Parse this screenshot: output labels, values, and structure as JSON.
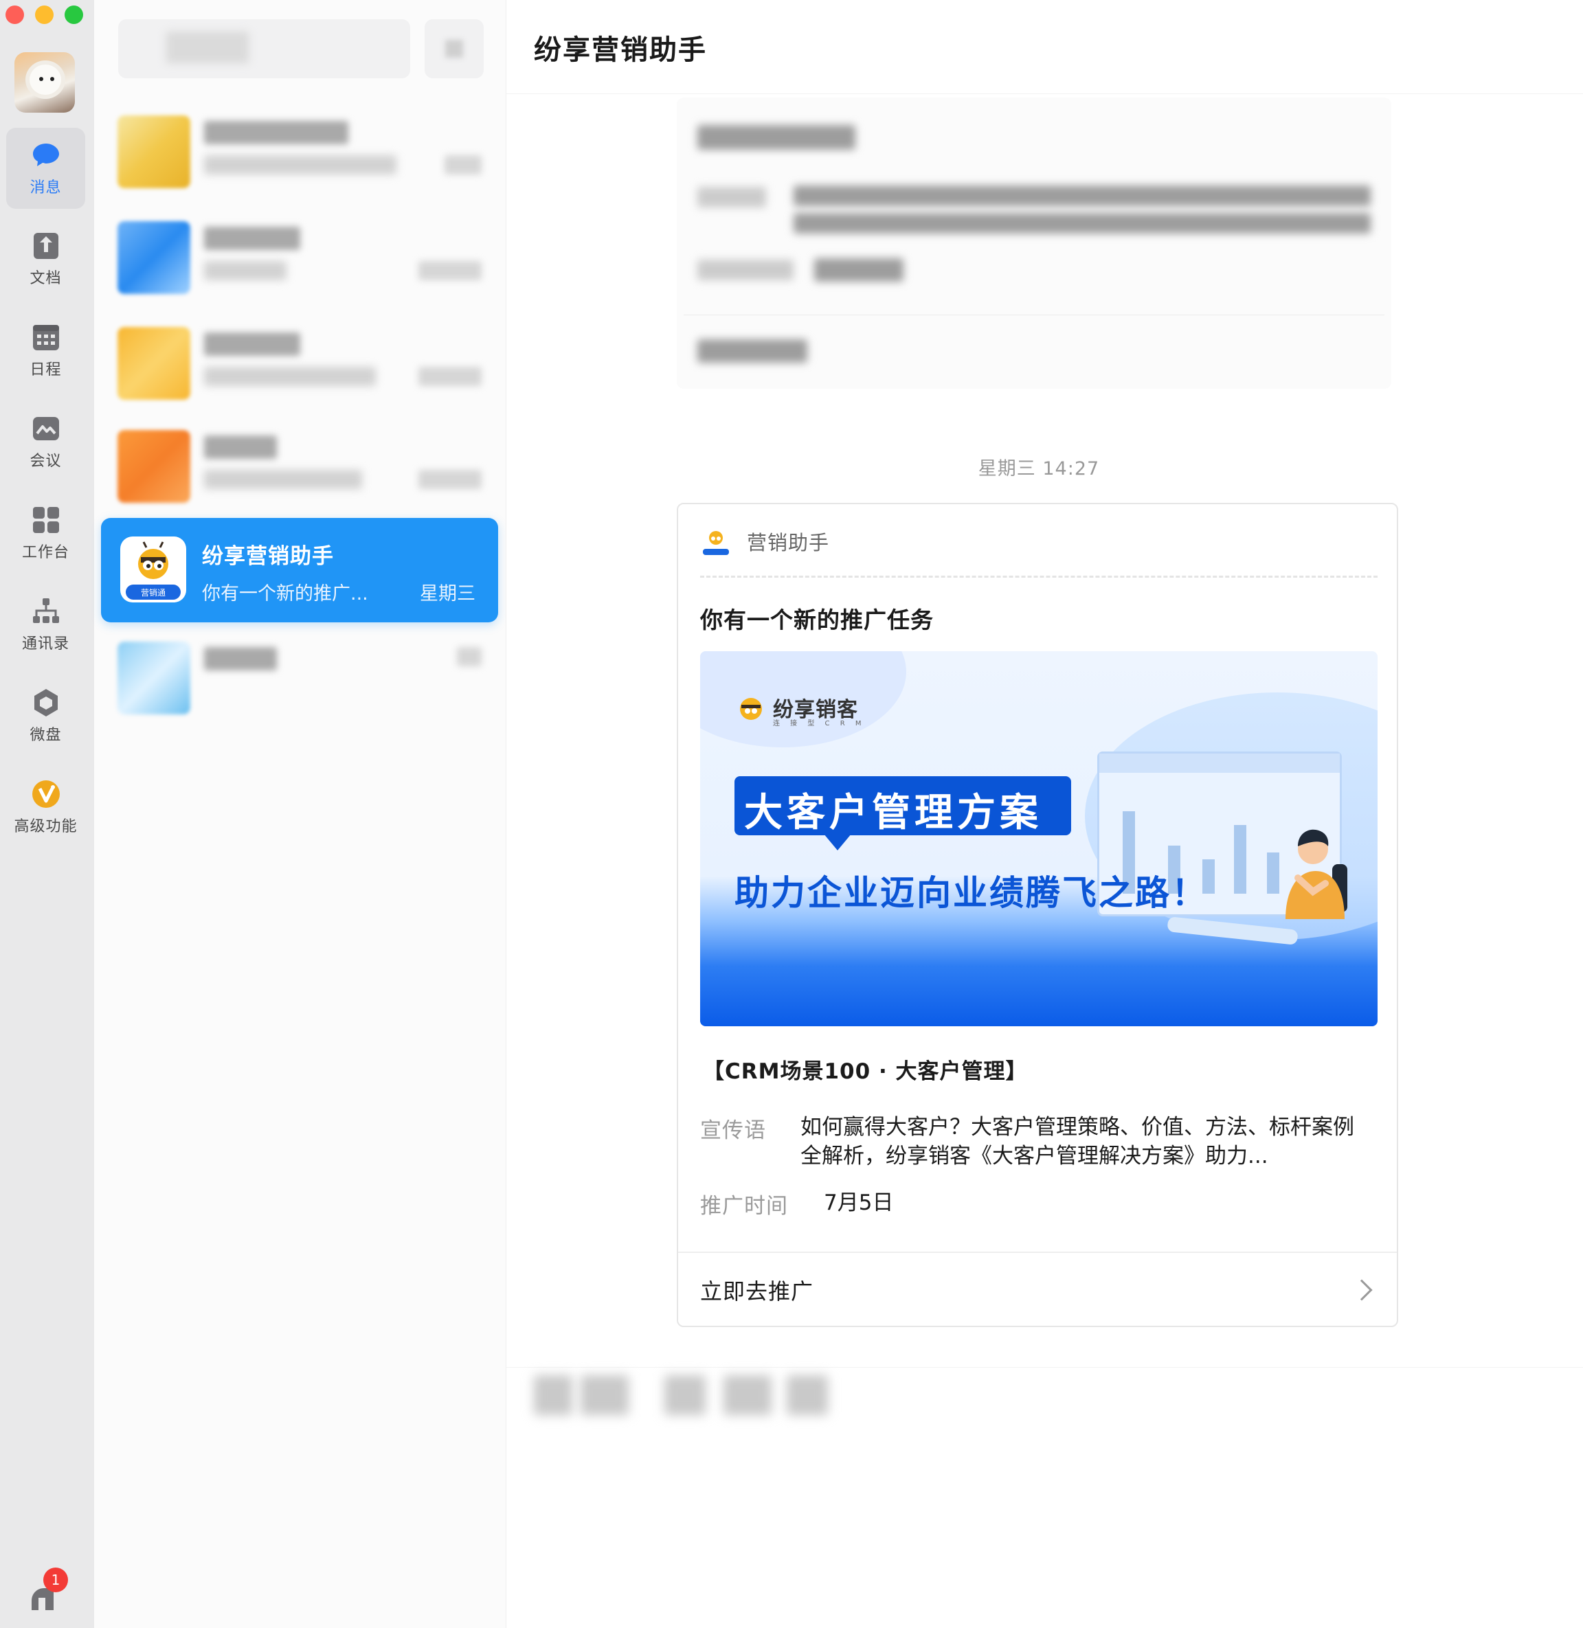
{
  "window": {
    "controls": [
      "close",
      "minimize",
      "zoom"
    ]
  },
  "nav": {
    "items": [
      {
        "label": "消息",
        "icon": "message-bubble-icon",
        "active": true
      },
      {
        "label": "文档",
        "icon": "document-icon",
        "active": false
      },
      {
        "label": "日程",
        "icon": "calendar-icon",
        "active": false
      },
      {
        "label": "会议",
        "icon": "meeting-icon",
        "active": false
      },
      {
        "label": "工作台",
        "icon": "workbench-grid-icon",
        "active": false
      },
      {
        "label": "通讯录",
        "icon": "contacts-org-icon",
        "active": false
      },
      {
        "label": "微盘",
        "icon": "drive-icon",
        "active": false
      },
      {
        "label": "高级功能",
        "icon": "premium-v-icon",
        "active": false
      }
    ],
    "bottom_badge": "1"
  },
  "conversations": {
    "selected": {
      "title": "纷享营销助手",
      "preview": "你有一个新的推广...",
      "time": "星期三",
      "avatar_label": "营销通"
    }
  },
  "chat": {
    "title": "纷享营销助手",
    "timestamp": "星期三 14:27",
    "card": {
      "source": "营销助手",
      "title": "你有一个新的推广任务",
      "banner": {
        "brand": "纷享销客",
        "brand_sub": "连 接 型 C R M",
        "headline": "大客户管理方案",
        "slogan": "助力企业迈向业绩腾飞之路！"
      },
      "case_title": "【CRM场景100 · 大客户管理】",
      "slogan_label": "宣传语",
      "slogan_value": "如何赢得大客户？大客户管理策略、价值、方法、标杆案例全解析，纷享销客《大客户管理解决方案》助力...",
      "time_label": "推广时间",
      "time_value": "7月5日",
      "cta": "立即去推广"
    }
  },
  "colors": {
    "accent": "#2095f6",
    "nav_active": "#2a7bf6",
    "banner_blue": "#0b55d6",
    "badge": "#f33b36"
  }
}
